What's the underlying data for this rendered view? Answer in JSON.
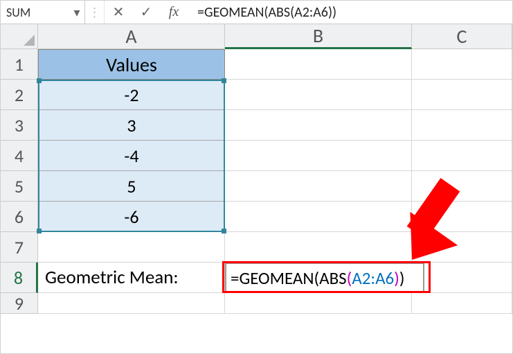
{
  "formulaBar": {
    "nameBox": "SUM",
    "cancelLabel": "✕",
    "enterLabel": "✓",
    "fxLabel": "fx",
    "formula": "=GEOMEAN(ABS(A2:A6))"
  },
  "columns": {
    "A": "A",
    "B": "B",
    "C": "C"
  },
  "rows": [
    "1",
    "2",
    "3",
    "4",
    "5",
    "6",
    "7",
    "8",
    "9"
  ],
  "table": {
    "header": "Values",
    "values": [
      "-2",
      "3",
      "-4",
      "5",
      "-6"
    ]
  },
  "row8": {
    "label": "Geometric Mean:",
    "formula_parts": {
      "eq": "=",
      "fn1": "GEOMEAN",
      "open1": "(",
      "fn2": "ABS",
      "open2": "(",
      "range": "A2:A6",
      "close2": ")",
      "close1": ")"
    }
  }
}
